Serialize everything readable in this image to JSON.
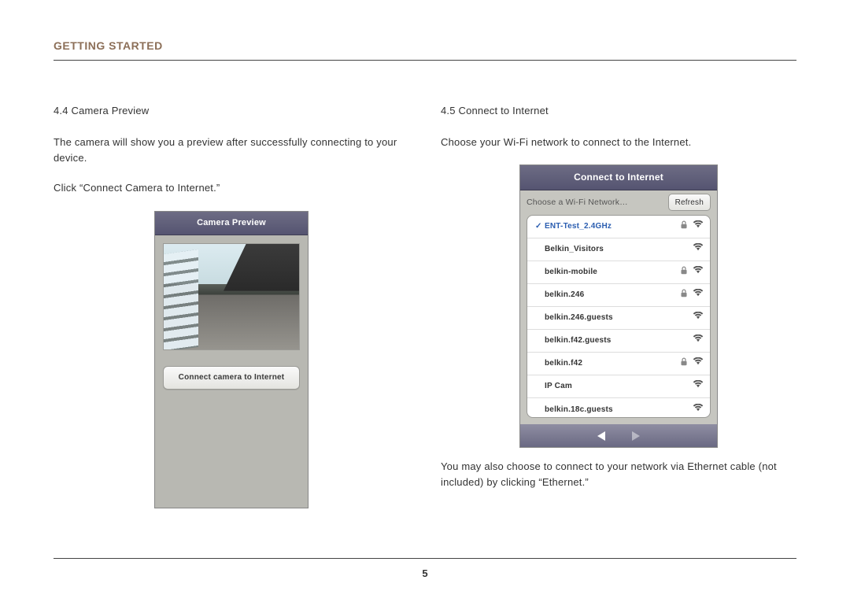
{
  "header": {
    "title": "GETTING STARTED"
  },
  "left": {
    "section_title": "4.4 Camera Preview",
    "para1": "The camera will show you a preview after successfully connecting to your device.",
    "para2": "Click “Connect Camera to Internet.”",
    "phone": {
      "navbar": "Camera Preview",
      "connect_label": "Connect camera to Internet"
    }
  },
  "right": {
    "section_title": "4.5 Connect to Internet",
    "para1": "Choose your Wi-Fi network to connect to the Internet.",
    "para2": "You may also choose to connect to your network via Ethernet cable (not included) by clicking “Ethernet.”",
    "phone": {
      "navbar": "Connect to Internet",
      "choose_label": "Choose a Wi-Fi Network…",
      "refresh_label": "Refresh",
      "networks": [
        {
          "name": "ENT-Test_2.4GHz",
          "locked": true,
          "selected": true
        },
        {
          "name": "Belkin_Visitors",
          "locked": false,
          "selected": false
        },
        {
          "name": "belkin-mobile",
          "locked": true,
          "selected": false
        },
        {
          "name": "belkin.246",
          "locked": true,
          "selected": false
        },
        {
          "name": "belkin.246.guests",
          "locked": false,
          "selected": false
        },
        {
          "name": "belkin.f42.guests",
          "locked": false,
          "selected": false
        },
        {
          "name": "belkin.f42",
          "locked": true,
          "selected": false
        },
        {
          "name": "IP Cam",
          "locked": false,
          "selected": false
        },
        {
          "name": "belkin.18c.guests",
          "locked": false,
          "selected": false
        }
      ]
    }
  },
  "page_number": "5"
}
